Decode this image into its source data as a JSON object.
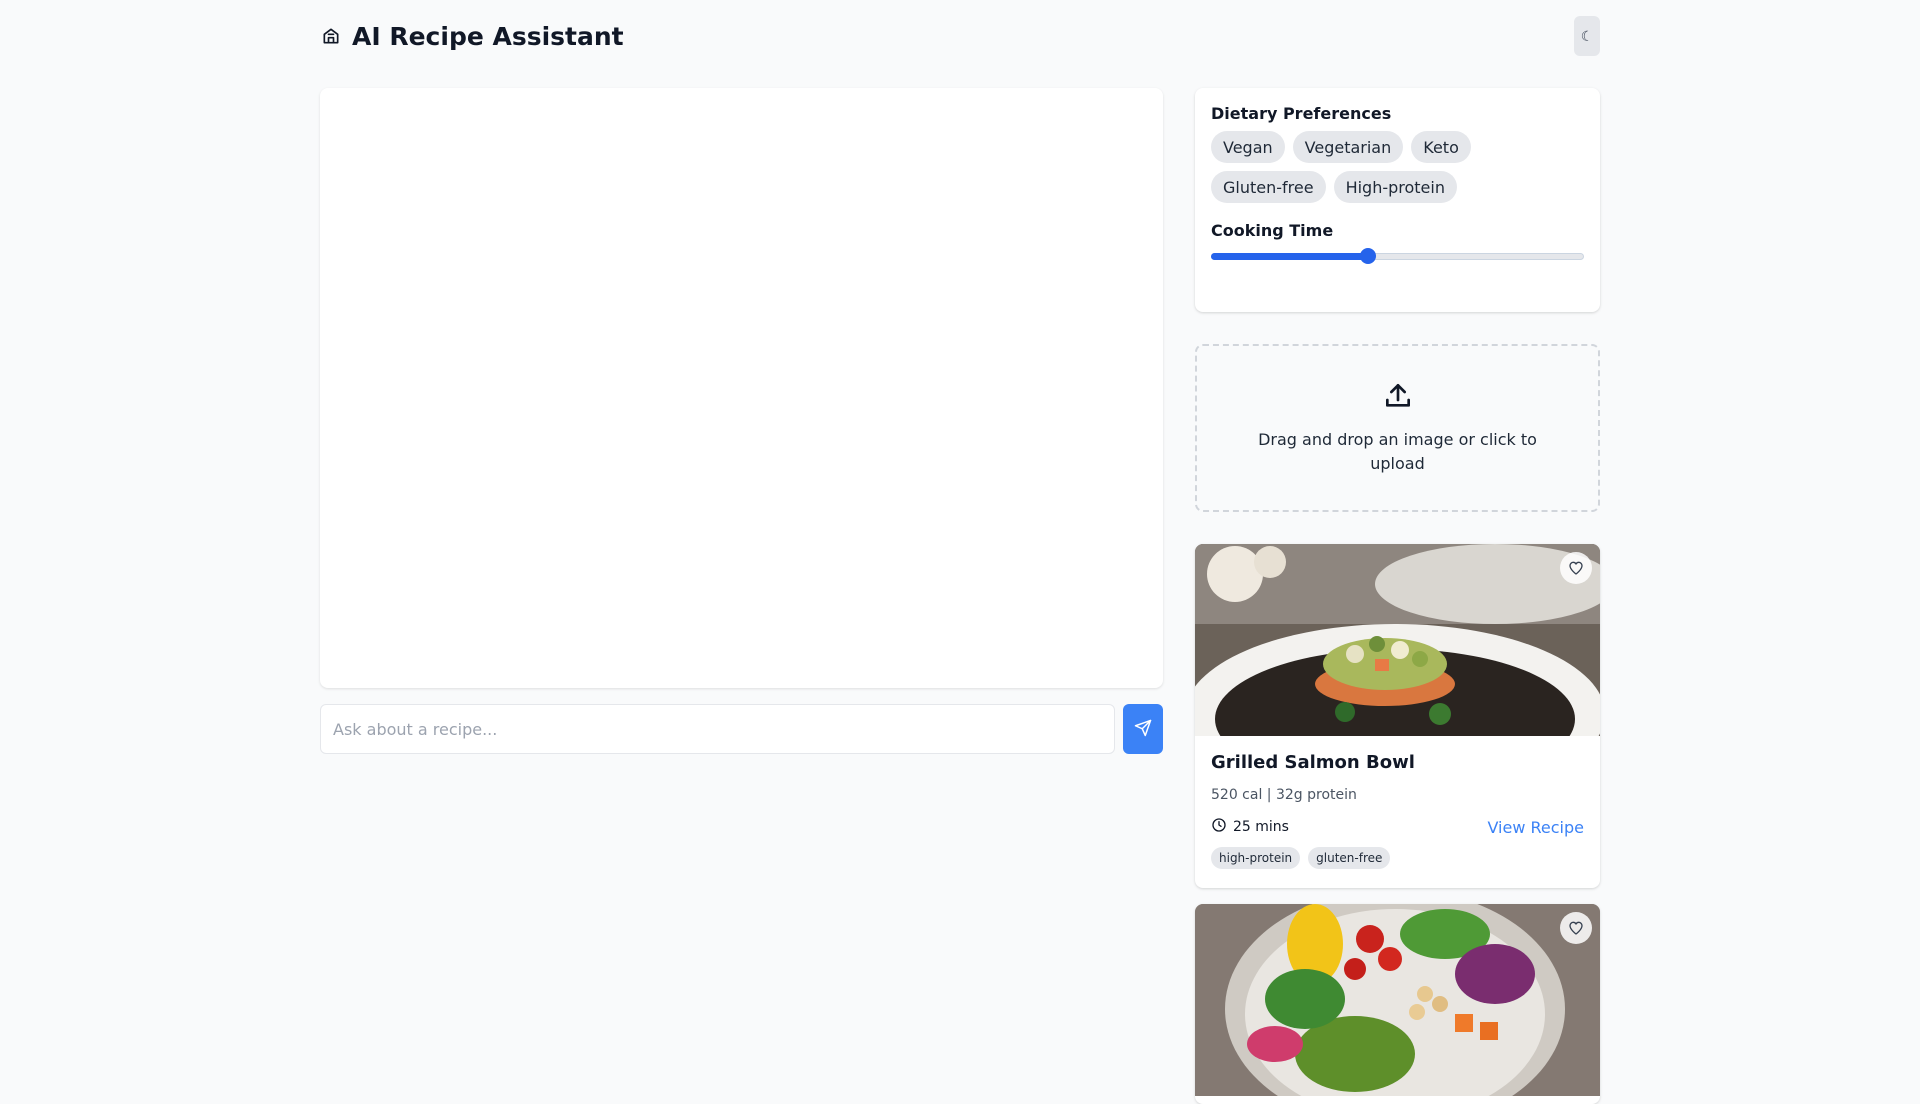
{
  "header": {
    "title": "AI Recipe Assistant",
    "theme_toggle_label": "☾"
  },
  "chat": {
    "input_placeholder": "Ask about a recipe...",
    "input_value": ""
  },
  "preferences": {
    "dietary_title": "Dietary Preferences",
    "dietary_options": [
      "Vegan",
      "Vegetarian",
      "Keto",
      "Gluten-free",
      "High-protein"
    ],
    "cooking_time_title": "Cooking Time",
    "cooking_time_level": 0.42
  },
  "upload": {
    "text": "Drag and drop an image or click to upload"
  },
  "recipes": [
    {
      "title": "Grilled Salmon Bowl",
      "nutrition": "520 cal | 32g protein",
      "time": "25 mins",
      "link_label": "View Recipe",
      "tags": [
        "high-protein",
        "gluten-free"
      ]
    }
  ],
  "colors": {
    "accent": "#3b82f6",
    "slider": "#2563eb",
    "pill_bg": "#e5e7eb",
    "page_bg": "#f9fafb"
  }
}
